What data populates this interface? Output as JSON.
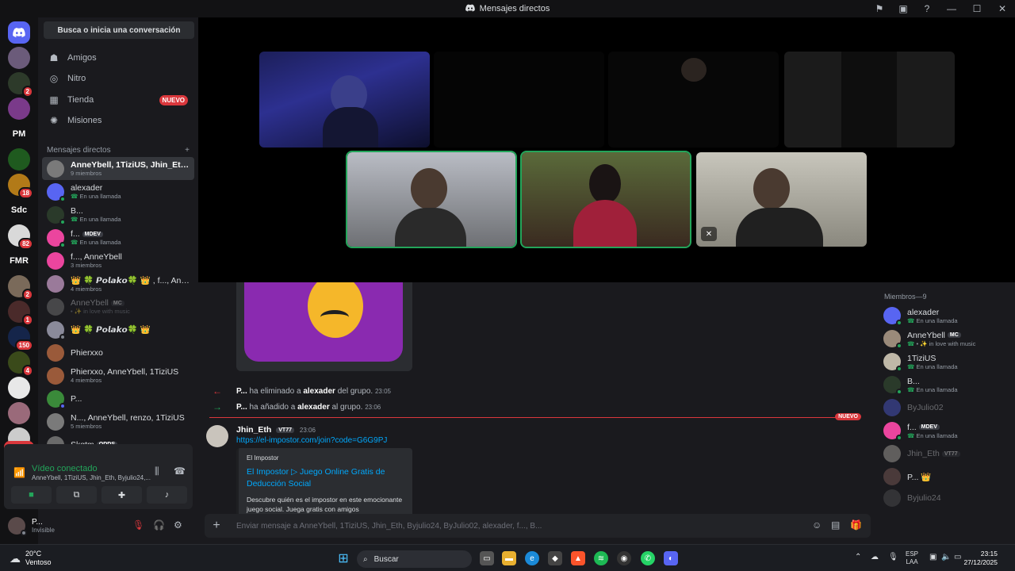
{
  "window": {
    "title": "Mensajes directos"
  },
  "servers": {
    "text_items": [
      "PM",
      "Sdc",
      "FMR"
    ],
    "badges": [
      "2",
      "18",
      "82",
      "2",
      "1",
      "150",
      "4"
    ],
    "nuevo": "NUEVO"
  },
  "sidebar": {
    "search_label": "Busca o inicia una conversación",
    "nav": [
      {
        "label": "Amigos",
        "icon": "friends-icon"
      },
      {
        "label": "Nitro",
        "icon": "nitro-icon"
      },
      {
        "label": "Tienda",
        "icon": "shop-icon",
        "badge": "NUEVO"
      },
      {
        "label": "Misiones",
        "icon": "quests-icon"
      }
    ],
    "dm_header": "Mensajes directos",
    "dms": [
      {
        "name": "AnneYbell, 1TiziUS, Jhin_Eth, ...",
        "sub": "9 miembros",
        "active": true
      },
      {
        "name": "alexader",
        "sub": "En una llamada",
        "call": true
      },
      {
        "name": "B...",
        "sub": "En una llamada",
        "call": true
      },
      {
        "name": "f...",
        "tag": "MDEV",
        "sub": "En una llamada",
        "call": true
      },
      {
        "name": "f..., AnneYbell",
        "sub": "3 miembros"
      },
      {
        "name": "👑 🍀 𝙋𝙤𝙡𝙖𝙠𝙤🍀 👑 , f..., Ann...",
        "sub": "4 miembros"
      },
      {
        "name": "AnneYbell",
        "tag": "MC",
        "sub": "• ✨ in love with music",
        "dim": true
      },
      {
        "name": "👑 🍀 𝙋𝙤𝙡𝙖𝙠𝙤🍀 👑",
        "sub": ""
      },
      {
        "name": "Phierxxo",
        "sub": ""
      },
      {
        "name": "Phierxxo, AnneYbell, 1TiziUS",
        "sub": "4 miembros"
      },
      {
        "name": "P...",
        "sub": ""
      },
      {
        "name": "N..., AnneYbell, renzo, 1TiziUS",
        "sub": "5 miembros"
      },
      {
        "name": "Skqtm",
        "tag": "ODDS",
        "sub": ""
      }
    ]
  },
  "voice": {
    "title": "Vídeo conectado",
    "sub": "AnneYbell, 1TiziUS, Jhin_Eth, Byjulio24,..."
  },
  "user": {
    "name": "P...",
    "status": "Invisible"
  },
  "chat": {
    "system": [
      {
        "actor": "P...",
        "action": "ha eliminado a",
        "target": "alexader",
        "tail": "del grupo.",
        "time": "23:05",
        "arrow": "←"
      },
      {
        "actor": "P...",
        "action": "ha añadido a",
        "target": "alexader",
        "tail": "al grupo.",
        "time": "23:06",
        "arrow": "→"
      }
    ],
    "divider_label": "NUEVO",
    "message": {
      "author": "Jhin_Eth",
      "tag": "VT77",
      "time": "23:06",
      "link": "https://el-impostor.com/join?code=G6G9PJ",
      "embed": {
        "provider": "El Impostor",
        "title": "El Impostor ▷ Juego Online Gratis de Deducción Social",
        "description": "Descubre quién es el impostor en este emocionante juego social. Juega gratis con amigos"
      }
    },
    "composer_placeholder": "Enviar mensaje a AnneYbell, 1TiziUS, Jhin_Eth, Byjulio24, ByJulio02, alexader, f..., B..."
  },
  "members": {
    "header": "Miembros—9",
    "list": [
      {
        "name": "alexader",
        "sub": "En una llamada",
        "call": true
      },
      {
        "name": "AnneYbell",
        "tag": "MC",
        "sub": "• ✨ in love with music",
        "call": true
      },
      {
        "name": "1TiziUS",
        "sub": "En una llamada",
        "call": true
      },
      {
        "name": "B...",
        "sub": "En una llamada",
        "call": true
      },
      {
        "name": "ByJulio02",
        "sub": "",
        "dim": true
      },
      {
        "name": "f...",
        "tag": "MDEV",
        "sub": "En una llamada",
        "call": true
      },
      {
        "name": "Jhin_Eth",
        "tag": "VT77",
        "sub": "",
        "dim": true
      },
      {
        "name": "P... 👑",
        "sub": ""
      },
      {
        "name": "Byjulio24",
        "sub": "",
        "dim": true
      }
    ]
  },
  "taskbar": {
    "weather_temp": "20°C",
    "weather_desc": "Ventoso",
    "search_label": "Buscar",
    "lang": "ESP",
    "lang2": "LAA",
    "time": "23:15",
    "date": "27/12/2025"
  },
  "colors": {
    "accent": "#5865f2",
    "green": "#23a55a",
    "red": "#da373c",
    "link": "#00a8fc"
  }
}
